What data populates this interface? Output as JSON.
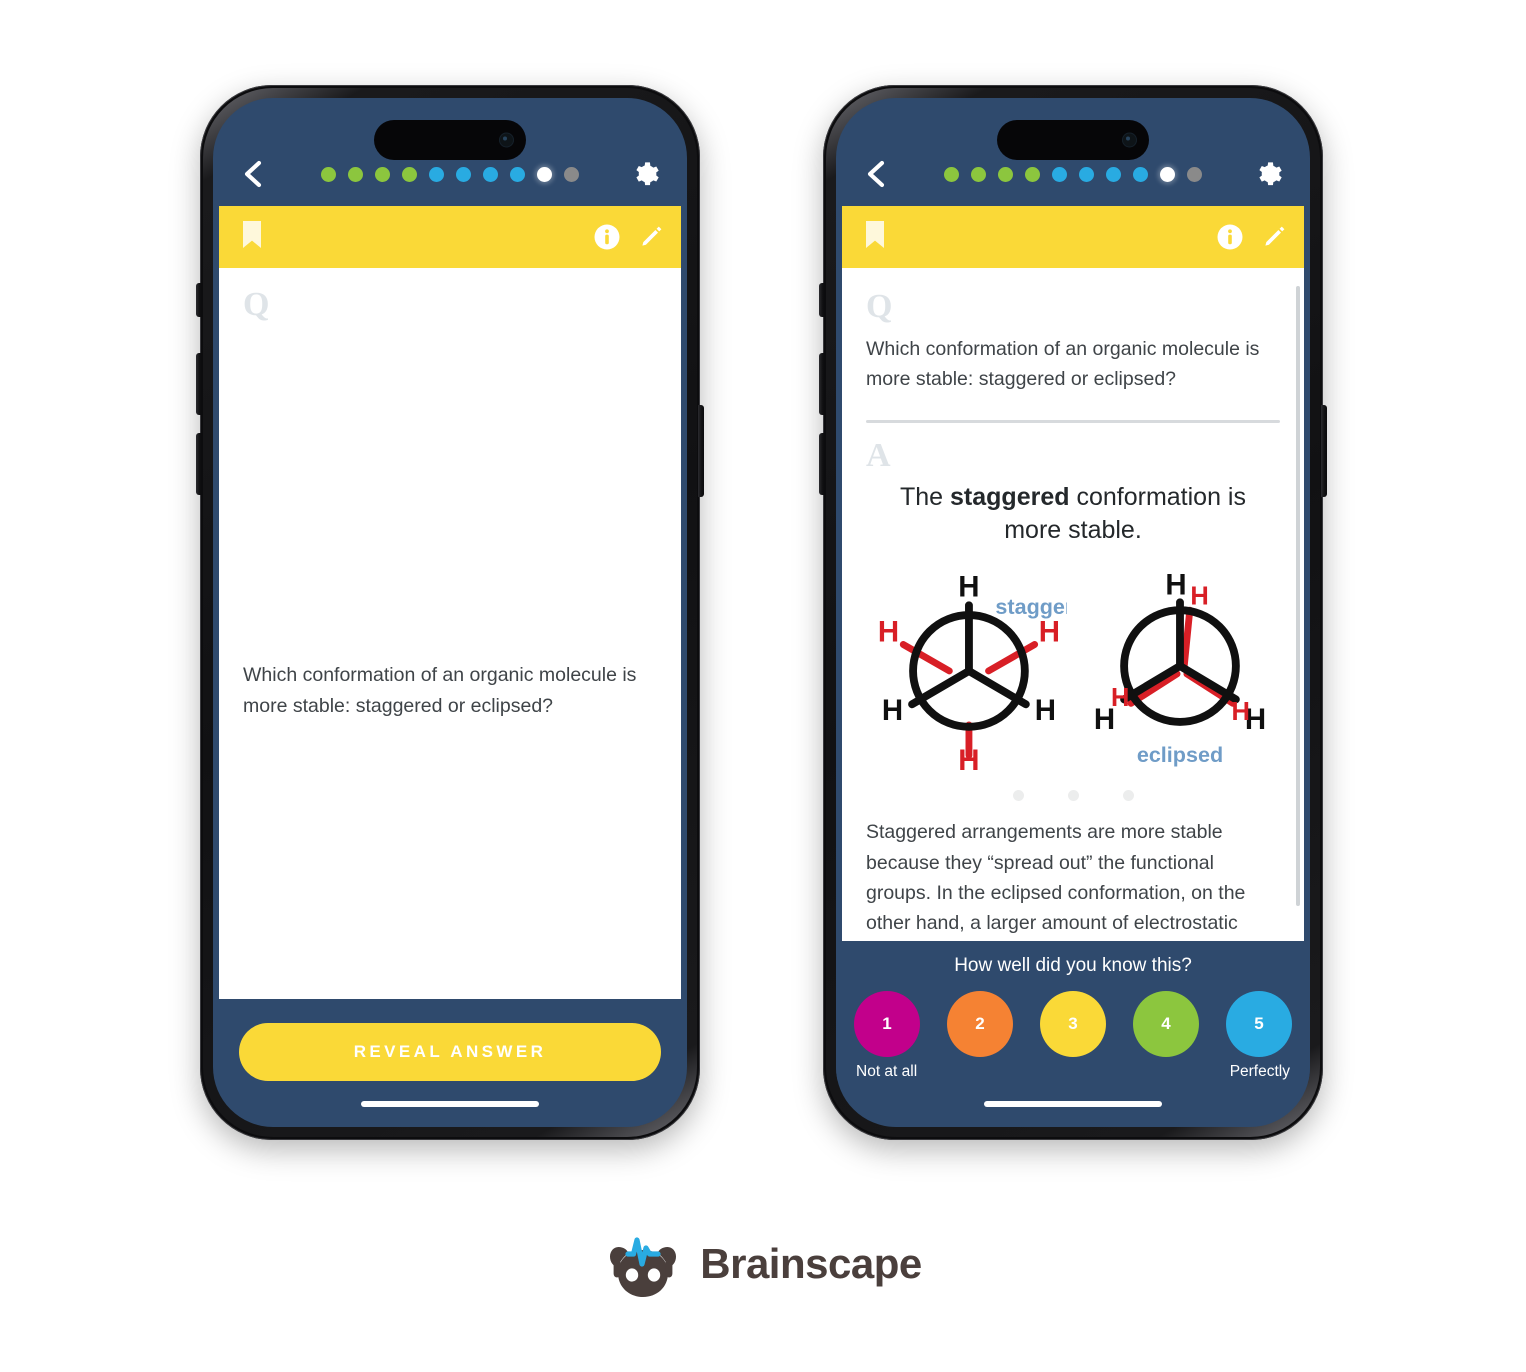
{
  "app": {
    "brand_name": "Brainscape"
  },
  "colors": {
    "yellow": "#FAD937",
    "navy": "#2F4A6D",
    "green_dot": "#8CC63E",
    "blue_dot": "#29ABE2",
    "white_dot": "#FFFFFF",
    "gray_dot": "#8A8A8A",
    "molecule_black": "#101010",
    "molecule_red": "#D81F26",
    "molecule_label_blue": "#6F9CC7"
  },
  "progress_dots": [
    {
      "state": "mastered",
      "color": "#8CC63E"
    },
    {
      "state": "mastered",
      "color": "#8CC63E"
    },
    {
      "state": "mastered",
      "color": "#8CC63E"
    },
    {
      "state": "mastered",
      "color": "#8CC63E"
    },
    {
      "state": "learning",
      "color": "#29ABE2"
    },
    {
      "state": "learning",
      "color": "#29ABE2"
    },
    {
      "state": "learning",
      "color": "#29ABE2"
    },
    {
      "state": "learning",
      "color": "#29ABE2"
    },
    {
      "state": "current",
      "color": "#FFFFFF"
    },
    {
      "state": "upcoming",
      "color": "#8A8A8A"
    }
  ],
  "icons": {
    "back": "chevron-left-icon",
    "settings": "gear-icon",
    "bookmark": "bookmark-icon",
    "info": "info-icon",
    "edit": "pencil-icon"
  },
  "card": {
    "q_marker": "Q",
    "a_marker": "A",
    "question": "Which conformation of an organic molecule is more stable: staggered or eclipsed?",
    "answer_heading_pre": "The ",
    "answer_heading_bold": "staggered",
    "answer_heading_post": " conformation is more stable.",
    "explanation": "Staggered arrangements are more stable because they “spread out” the functional groups. In the eclipsed conformation, on the other hand, a larger amount of electrostatic repulsion exists between the closely",
    "carousel_dot_count": 3
  },
  "diagram": {
    "label_left": "staggered",
    "label_right": "eclipsed",
    "atom_label": "H",
    "staggered": {
      "front_bond_angles_deg": [
        90,
        210,
        330
      ],
      "back_bond_angles_deg": [
        150,
        30,
        270
      ]
    },
    "eclipsed": {
      "front_bond_angles_deg": [
        90,
        210,
        330
      ],
      "back_bond_angles_deg": [
        90,
        210,
        330
      ]
    }
  },
  "phone1": {
    "reveal_label": "REVEAL ANSWER"
  },
  "phone2": {
    "rating_question": "How well did you know this?",
    "ratings": [
      {
        "value": "1",
        "color": "#C2008B"
      },
      {
        "value": "2",
        "color": "#F58233"
      },
      {
        "value": "3",
        "color": "#FAD937"
      },
      {
        "value": "4",
        "color": "#8CC63E"
      },
      {
        "value": "5",
        "color": "#29ABE2"
      }
    ],
    "label_low": "Not at all",
    "label_high": "Perfectly"
  }
}
